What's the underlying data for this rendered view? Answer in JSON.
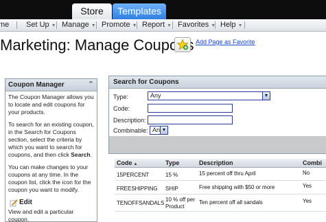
{
  "tabs": [
    {
      "label": "Store"
    },
    {
      "label": "Templates"
    }
  ],
  "menu": {
    "items": [
      {
        "label": "me"
      },
      {
        "label": "Set Up"
      },
      {
        "label": "Manage"
      },
      {
        "label": "Promote"
      },
      {
        "label": "Report"
      },
      {
        "label": "Favorites"
      },
      {
        "label": "Help"
      }
    ]
  },
  "page": {
    "title": "Marketing: Manage Coupons",
    "favorite_link": "Add Page as Favorite"
  },
  "coupon_manager": {
    "title": "Coupon Manager",
    "intro": "The Coupon Manager allows you to locate and edit coupons for your products.",
    "search_help_before": "To search for an existing coupon, in the Search for Coupons section, select the criteria by which you want to search for coupons, and then click ",
    "search_help_bold": "Search",
    "search_help_after": ".",
    "changes_help": "You can make changes to your coupons at any time. In the coupon list, click the icon for the coupon you want to modify.",
    "edit_label": "Edit",
    "edit_desc": "View and edit a particular coupon."
  },
  "search": {
    "title": "Search for Coupons",
    "type_label": "Type:",
    "type_value": "Any",
    "code_label": "Code:",
    "code_value": "",
    "description_label": "Description:",
    "description_value": "",
    "combinable_label": "Combinable:",
    "combinable_value": "Any"
  },
  "table": {
    "columns": [
      "Code",
      "Type",
      "Description",
      "Combi"
    ],
    "rows": [
      {
        "code": "15PERCENT",
        "type": "15 %",
        "description": "15 percent off thru April",
        "combinable": "No"
      },
      {
        "code": "FREESHIPPING",
        "type": "SHIP",
        "description": "Free shipping with $50 or more",
        "combinable": "Yes"
      },
      {
        "code": "TENOFFSANDALS",
        "type_line1": "10 % off per",
        "type_line2": "Product",
        "description": "Ten percent off all sandals",
        "combinable": "Yes"
      }
    ]
  }
}
